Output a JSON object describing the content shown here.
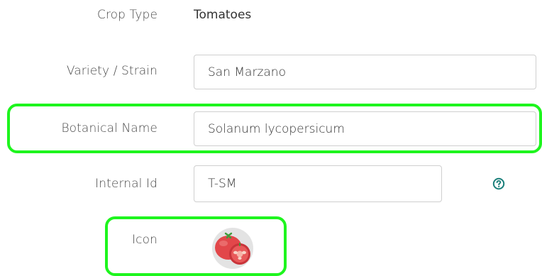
{
  "form": {
    "crop_type": {
      "label": "Crop Type",
      "value": "Tomatoes"
    },
    "variety": {
      "label": "Variety / Strain",
      "value": "San Marzano"
    },
    "botanical_name": {
      "label": "Botanical Name",
      "value": "Solanum lycopersicum"
    },
    "internal_id": {
      "label": "Internal Id",
      "value": "T-SM",
      "help_icon": "question-circle-icon"
    },
    "icon": {
      "label": "Icon",
      "image": "tomato-icon"
    }
  },
  "colors": {
    "highlight": "#1ef51e",
    "help_icon": "#1a7f7a",
    "tomato_red": "#e2474a",
    "icon_background": "#e3e3e3"
  }
}
